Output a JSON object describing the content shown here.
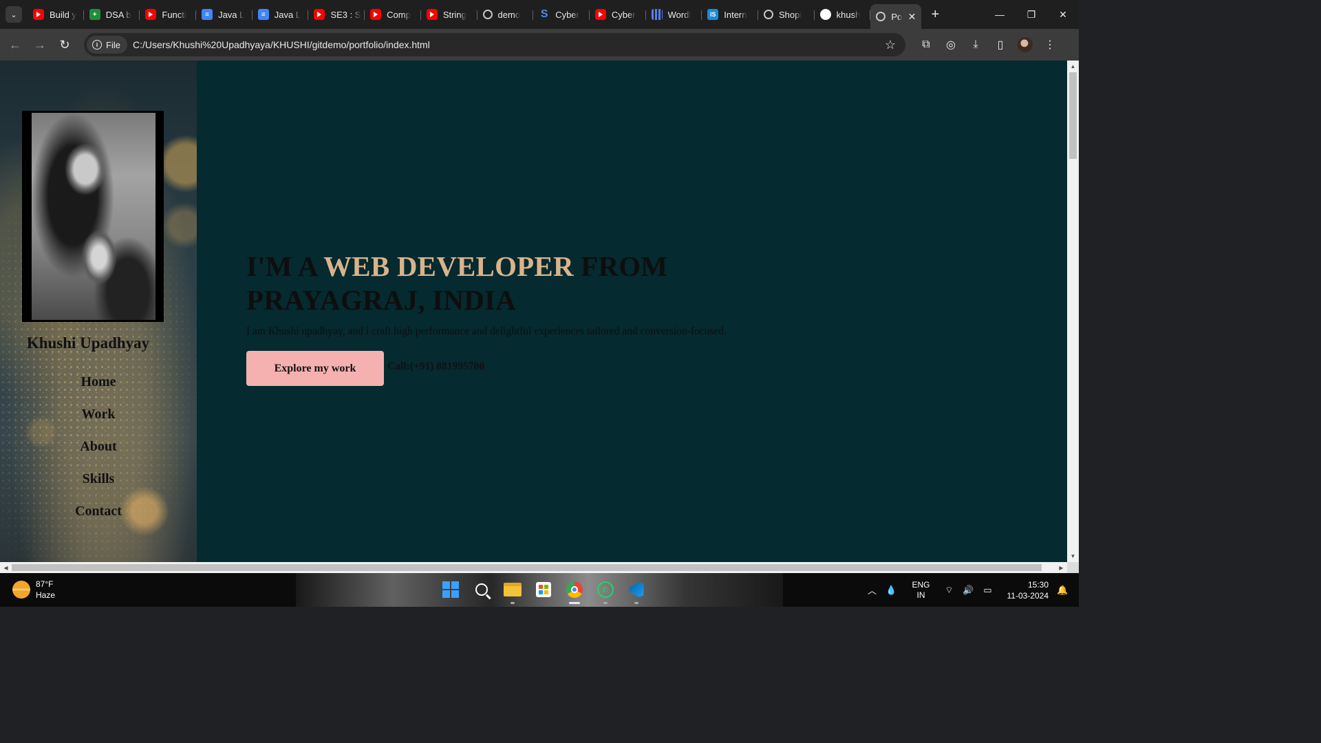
{
  "browser": {
    "tabs": [
      {
        "title": "Build y",
        "favicon": "youtube-icon"
      },
      {
        "title": "DSA b",
        "favicon": "sheets-icon"
      },
      {
        "title": "Functi",
        "favicon": "youtube-icon"
      },
      {
        "title": "Java L",
        "favicon": "docs-icon"
      },
      {
        "title": "Java L",
        "favicon": "docs-icon"
      },
      {
        "title": "SE3 : S",
        "favicon": "youtube-icon"
      },
      {
        "title": "Comp",
        "favicon": "youtube-icon"
      },
      {
        "title": "String",
        "favicon": "youtube-icon"
      },
      {
        "title": "demo",
        "favicon": "globe-icon"
      },
      {
        "title": "Cyber",
        "favicon": "s-icon"
      },
      {
        "title": "Cyber",
        "favicon": "youtube-icon"
      },
      {
        "title": "Wordl",
        "favicon": "grid-icon"
      },
      {
        "title": "Intern",
        "favicon": "is-icon"
      },
      {
        "title": "Shopi",
        "favicon": "globe-icon"
      },
      {
        "title": "khush",
        "favicon": "github-icon"
      }
    ],
    "active_tab": {
      "title": "Po",
      "favicon": "globe-icon"
    },
    "chip_label": "File",
    "url": "C:/Users/Khushi%20Upadhyaya/KHUSHI/gitdemo/portfolio/index.html"
  },
  "page": {
    "profile_name": "Khushi Upadhyay",
    "nav": [
      "Home",
      "Work",
      "About",
      "Skills",
      "Contact"
    ],
    "hero": {
      "prefix": "I'M A ",
      "accent": "WEB DEVELOPER",
      "suffix": " FROM PRAYAGRAJ, INDIA",
      "tagline": "I am Khushi upadhyay, and i craft high performance and delightful experiences tailored and conversion-focused.",
      "cta_label": "Explore my work",
      "call_text": "Call:(+91) 881995700"
    },
    "colors": {
      "background": "#052a30",
      "accent": "#d9b38c",
      "button": "#f4b1b0"
    }
  },
  "taskbar": {
    "temperature": "87°F",
    "condition": "Haze",
    "apps": [
      "windows-start-icon",
      "search-icon",
      "file-explorer-icon",
      "microsoft-store-icon",
      "chrome-icon",
      "whatsapp-icon",
      "vscode-icon"
    ],
    "lang_top": "ENG",
    "lang_bottom": "IN",
    "time": "15:30",
    "date": "11-03-2024"
  }
}
